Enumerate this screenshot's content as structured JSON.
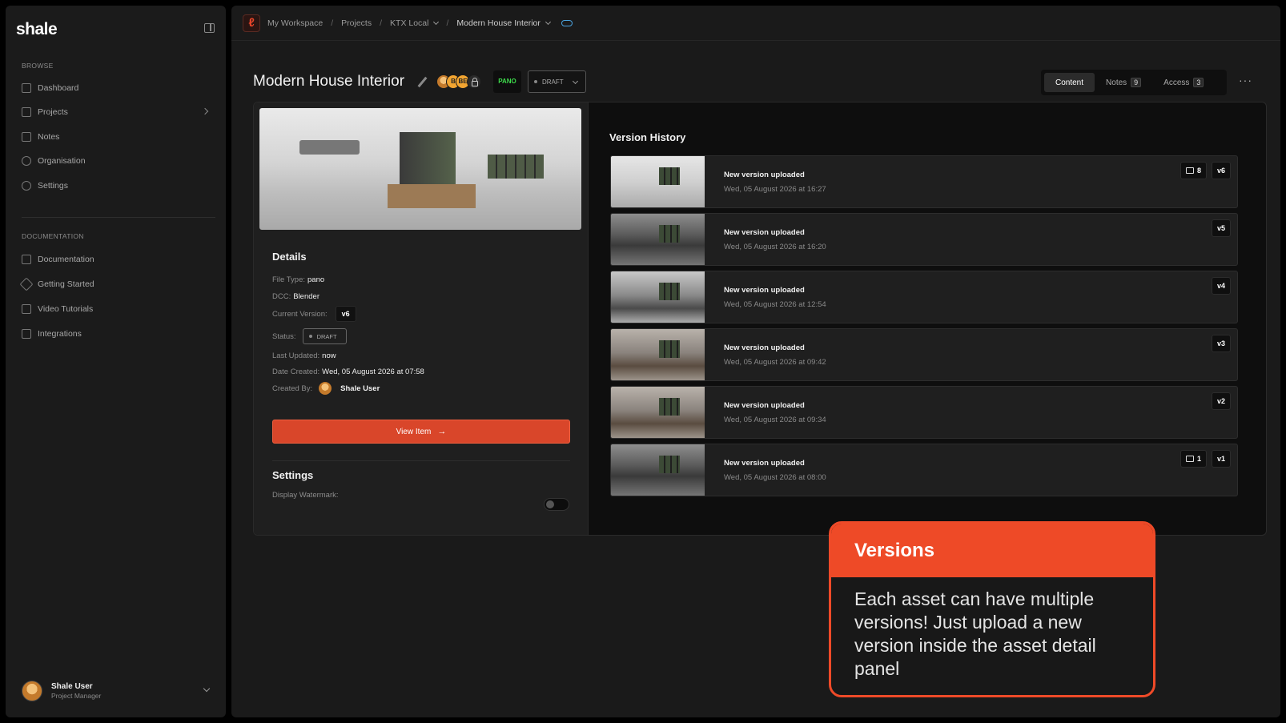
{
  "app": {
    "logo": "shale"
  },
  "sidebar": {
    "browse_label": "BROWSE",
    "browse_items": [
      {
        "label": "Dashboard",
        "icon": "grid-icon"
      },
      {
        "label": "Projects",
        "icon": "folders-icon"
      },
      {
        "label": "Notes",
        "icon": "notebook-icon"
      },
      {
        "label": "Organisation",
        "icon": "user-icon"
      },
      {
        "label": "Settings",
        "icon": "gear-icon"
      }
    ],
    "docs_label": "DOCUMENTATION",
    "docs_items": [
      {
        "label": "Documentation",
        "icon": "library-icon"
      },
      {
        "label": "Getting Started",
        "icon": "compass-icon"
      },
      {
        "label": "Video Tutorials",
        "icon": "video-icon"
      },
      {
        "label": "Integrations",
        "icon": "puzzle-icon"
      }
    ],
    "user": {
      "name": "Shale User",
      "role": "Project Manager"
    }
  },
  "breadcrumb": {
    "workspace": "My Workspace",
    "projects": "Projects",
    "project": "KTX Local",
    "asset": "Modern House Interior"
  },
  "asset": {
    "title": "Modern House Interior",
    "avatars": [
      "B",
      "BE"
    ],
    "type_badge": "PANO",
    "status": "DRAFT"
  },
  "tabs": [
    {
      "label": "Content"
    },
    {
      "label": "Notes",
      "count": "9"
    },
    {
      "label": "Access",
      "count": "3"
    }
  ],
  "more_label": "···",
  "details": {
    "heading": "Details",
    "file_type_label": "File Type:",
    "file_type": "pano",
    "dcc_label": "DCC:",
    "dcc": "Blender",
    "current_version_label": "Current Version:",
    "current_version": "v6",
    "status_label": "Status:",
    "status": "DRAFT",
    "last_updated_label": "Last Updated:",
    "last_updated": "now",
    "date_created_label": "Date Created:",
    "date_created": "Wed, 05 August 2026 at 07:58",
    "created_by_label": "Created By:",
    "created_by": "Shale User",
    "view_button": "View Item",
    "arrow": "→"
  },
  "settings": {
    "heading": "Settings",
    "watermark_label": "Display Watermark:"
  },
  "version_history": {
    "heading": "Version History",
    "versions": [
      {
        "title": "New version uploaded",
        "date": "Wed, 05 August 2026 at 16:27",
        "tag": "v6",
        "comments": "8"
      },
      {
        "title": "New version uploaded",
        "date": "Wed, 05 August 2026 at 16:20",
        "tag": "v5"
      },
      {
        "title": "New version uploaded",
        "date": "Wed, 05 August 2026 at 12:54",
        "tag": "v4"
      },
      {
        "title": "New version uploaded",
        "date": "Wed, 05 August 2026 at 09:42",
        "tag": "v3"
      },
      {
        "title": "New version uploaded",
        "date": "Wed, 05 August 2026 at 09:34",
        "tag": "v2"
      },
      {
        "title": "New version uploaded",
        "date": "Wed, 05 August 2026 at 08:00",
        "tag": "v1",
        "comments": "1"
      }
    ]
  },
  "callout": {
    "title": "Versions",
    "body": "Each asset can have multiple versions! Just upload a new version inside the asset detail panel"
  },
  "colors": {
    "accent": "#e8452a",
    "pano_badge": "#3ddc4b",
    "link": "#4aa3df"
  }
}
